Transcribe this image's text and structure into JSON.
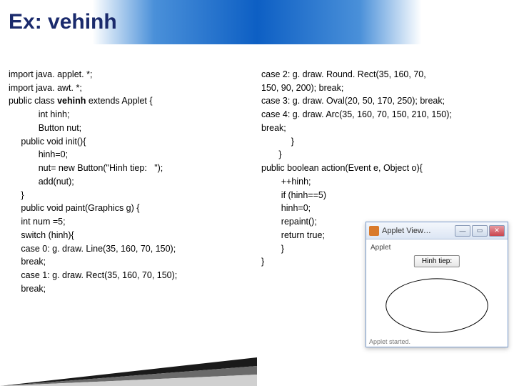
{
  "header": {
    "title": "Ex: vehinh"
  },
  "code_left": {
    "l1": "import java. applet. *;",
    "l2": "import java. awt. *;",
    "l3a": "public class ",
    "l3b": "vehinh ",
    "l3c": "extends Applet {",
    "l4": "int hinh;",
    "l5": "Button nut;",
    "l6": "public void init(){",
    "l7": "hinh=0;",
    "l8": "nut= new Button(\"Hinh tiep:   \");",
    "l9": "add(nut);",
    "l10": "}",
    "l11": "public void paint(Graphics g) {",
    "l12": "int num =5;",
    "l13": "switch (hinh){",
    "l14": "case 0: g. draw. Line(35, 160, 70, 150);",
    "l15": "break;",
    "l16": "case 1: g. draw. Rect(35, 160, 70, 150);",
    "l17": "break;"
  },
  "code_right": {
    "r1": "case 2: g. draw. Round. Rect(35, 160, 70,",
    "r2": "150, 90, 200); break;",
    "r3": "case 3: g. draw. Oval(20, 50, 170, 250); break;",
    "r4": "case 4: g. draw. Arc(35, 160, 70, 150, 210, 150);",
    "r5": "break;",
    "r6": "}",
    "r7": "}",
    "r8": "public boolean action(Event e, Object o){",
    "r9": "++hinh;",
    "r10": "if (hinh==5)",
    "r11": "hinh=0;",
    "r12": "repaint();",
    "r13": "return true;",
    "r14": "}",
    "r15": "}"
  },
  "applet": {
    "title": "Applet View…",
    "body_label": "Applet",
    "button_label": "Hinh tiep:",
    "status": "Applet started."
  }
}
